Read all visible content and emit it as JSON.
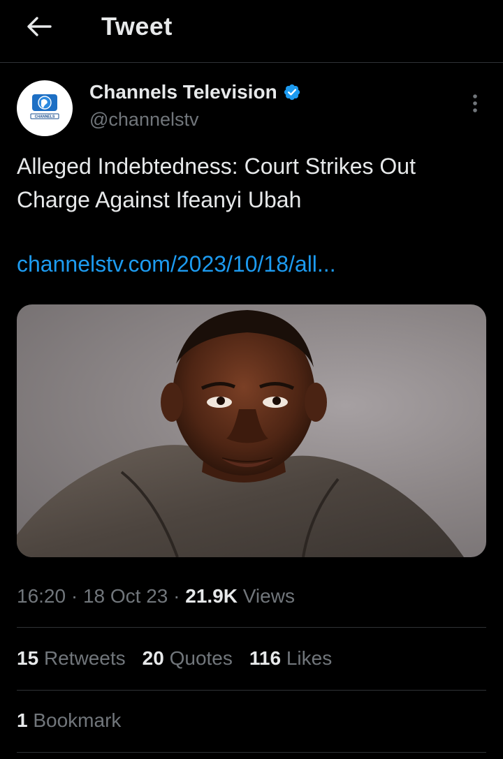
{
  "header": {
    "title": "Tweet",
    "back_icon": "arrow-left-icon"
  },
  "author": {
    "display_name": "Channels Television",
    "handle": "@channelstv",
    "verified": true,
    "avatar_text": "CHANNELS",
    "verified_color": "#1d9bf0"
  },
  "tweet": {
    "text": "Alleged Indebtedness: Court Strikes Out Charge Against Ifeanyi Ubah",
    "link": "channelstv.com/2023/10/18/all..."
  },
  "meta": {
    "time": "16:20",
    "separator": "·",
    "date": "18 Oct 23",
    "views_count": "21.9K",
    "views_label": "Views"
  },
  "stats": {
    "retweets_count": "15",
    "retweets_label": "Retweets",
    "quotes_count": "20",
    "quotes_label": "Quotes",
    "likes_count": "116",
    "likes_label": "Likes",
    "bookmarks_count": "1",
    "bookmarks_label": "Bookmark"
  },
  "colors": {
    "background": "#000000",
    "text_primary": "#e7e9ea",
    "text_secondary": "#71767b",
    "link": "#1d9bf0",
    "divider": "#2f3336"
  }
}
